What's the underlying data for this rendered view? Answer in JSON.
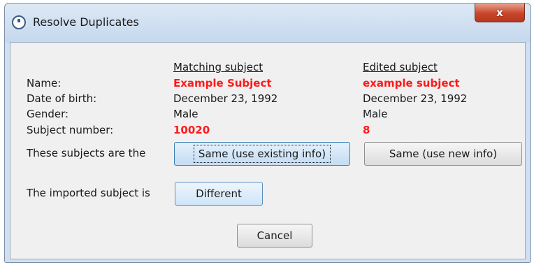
{
  "window": {
    "title": "Resolve Duplicates",
    "close_label": "x"
  },
  "columns": {
    "matching_header": "Matching subject",
    "edited_header": "Edited subject"
  },
  "rows": [
    {
      "label": "Name:",
      "matching": "Example Subject",
      "edited": "example subject"
    },
    {
      "label": "Date of birth:",
      "matching": "December 23, 1992",
      "edited": "December 23, 1992"
    },
    {
      "label": "Gender:",
      "matching": "Male",
      "edited": "Male"
    },
    {
      "label": "Subject number:",
      "matching": "10020",
      "edited": "8"
    }
  ],
  "same_row": {
    "label": "These subjects are the",
    "use_existing": "Same (use existing info)",
    "use_new": "Same (use new info)"
  },
  "different_row": {
    "label": "The imported subject is",
    "different": "Different"
  },
  "cancel_label": "Cancel",
  "colors": {
    "highlight": "#ff1a1a"
  }
}
